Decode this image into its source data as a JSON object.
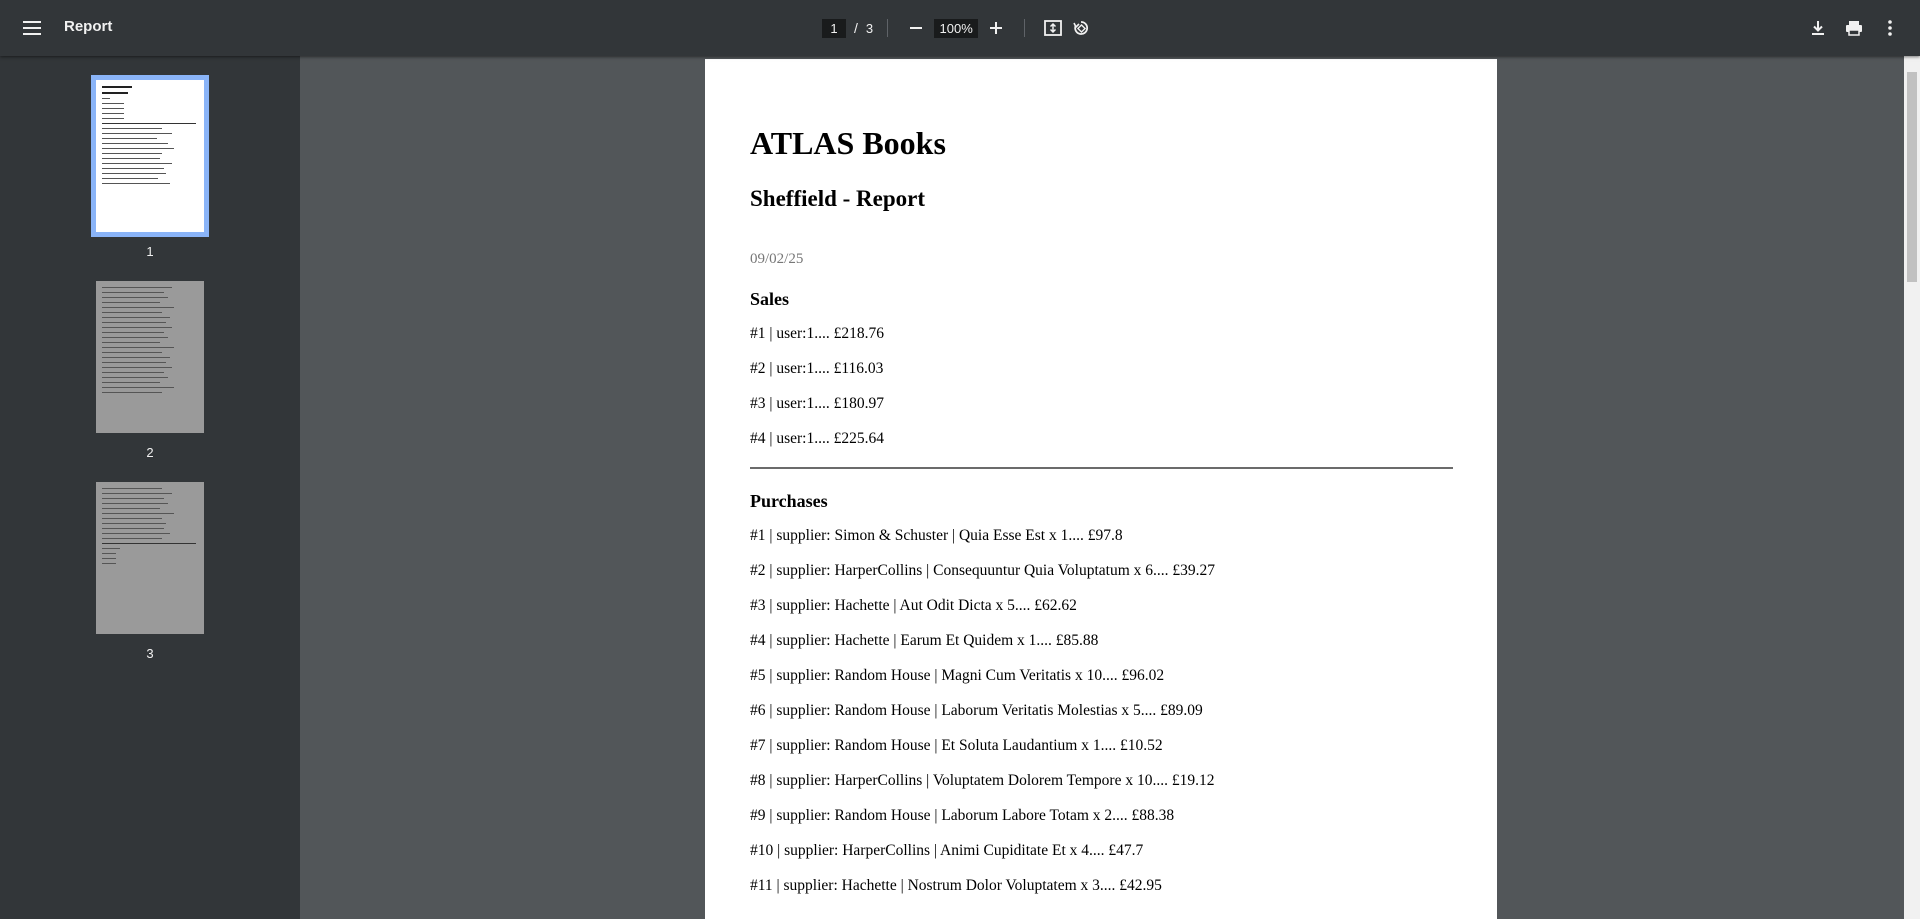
{
  "toolbar": {
    "title": "Report",
    "current_page": "1",
    "slash": "/",
    "total_pages": "3",
    "zoom": "100%"
  },
  "sidebar": {
    "thumbnails": [
      {
        "number": "1",
        "selected": true
      },
      {
        "number": "2",
        "selected": false
      },
      {
        "number": "3",
        "selected": false
      }
    ]
  },
  "document": {
    "title": "ATLAS Books",
    "subtitle": "Sheffield - Report",
    "date": "09/02/25",
    "sales_heading": "Sales",
    "sales": [
      "#1 | user:1.... £218.76",
      "#2 | user:1.... £116.03",
      "#3 | user:1.... £180.97",
      "#4 | user:1.... £225.64"
    ],
    "purchases_heading": "Purchases",
    "purchases": [
      "#1 | supplier: Simon & Schuster | Quia Esse Est x 1.... £97.8",
      "#2 | supplier: HarperCollins | Consequuntur Quia Voluptatum x 6.... £39.27",
      "#3 | supplier: Hachette | Aut Odit Dicta x 5.... £62.62",
      "#4 | supplier: Hachette | Earum Et Quidem x 1.... £85.88",
      "#5 | supplier: Random House | Magni Cum Veritatis x 10.... £96.02",
      "#6 | supplier: Random House | Laborum Veritatis Molestias x 5.... £89.09",
      "#7 | supplier: Random House | Et Soluta Laudantium x 1.... £10.52",
      "#8 | supplier: HarperCollins | Voluptatem Dolorem Tempore x 10.... £19.12",
      "#9 | supplier: Random House | Laborum Labore Totam x 2.... £88.38",
      "#10 | supplier: HarperCollins | Animi Cupiditate Et x 4.... £47.7",
      "#11 | supplier: Hachette | Nostrum Dolor Voluptatem x 3.... £42.95"
    ]
  },
  "colors": {
    "toolbar_bg": "#323639",
    "viewer_bg": "#525659",
    "selected_thumb_outline": "#8ab4f8"
  }
}
